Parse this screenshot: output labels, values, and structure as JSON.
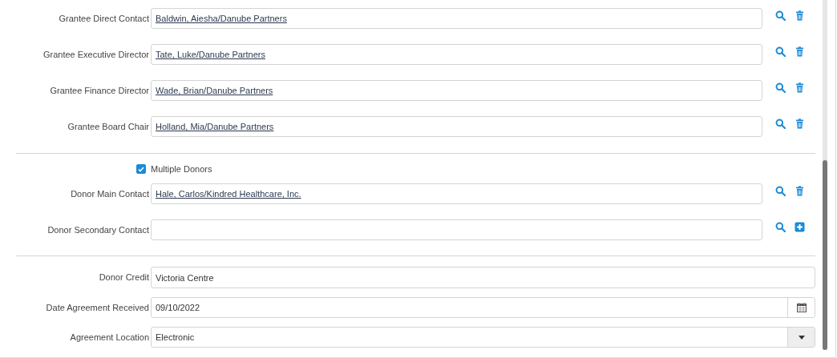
{
  "grantee_contacts": [
    {
      "label": "Grantee Direct Contact",
      "value": "Baldwin, Aiesha/Danube Partners",
      "kind": "removable"
    },
    {
      "label": "Grantee Executive Director",
      "value": "Tate, Luke/Danube Partners",
      "kind": "removable"
    },
    {
      "label": "Grantee Finance Director",
      "value": "Wade, Brian/Danube Partners",
      "kind": "removable"
    },
    {
      "label": "Grantee Board Chair",
      "value": "Holland, Mia/Danube Partners",
      "kind": "removable"
    }
  ],
  "multiple_donors": {
    "label": "Multiple Donors",
    "checked": true
  },
  "donor_contacts": [
    {
      "label": "Donor Main Contact",
      "value": "Hale, Carlos/Kindred Healthcare, Inc.",
      "kind": "removable"
    },
    {
      "label": "Donor Secondary Contact",
      "kind": "addable"
    }
  ],
  "fields": [
    {
      "kind": "text",
      "label": "Donor Credit",
      "value": "Victoria Centre"
    },
    {
      "kind": "date",
      "label": "Date Agreement Received",
      "value": "09/10/2022"
    },
    {
      "kind": "select",
      "label": "Agreement Location",
      "value": "Electronic"
    }
  ]
}
